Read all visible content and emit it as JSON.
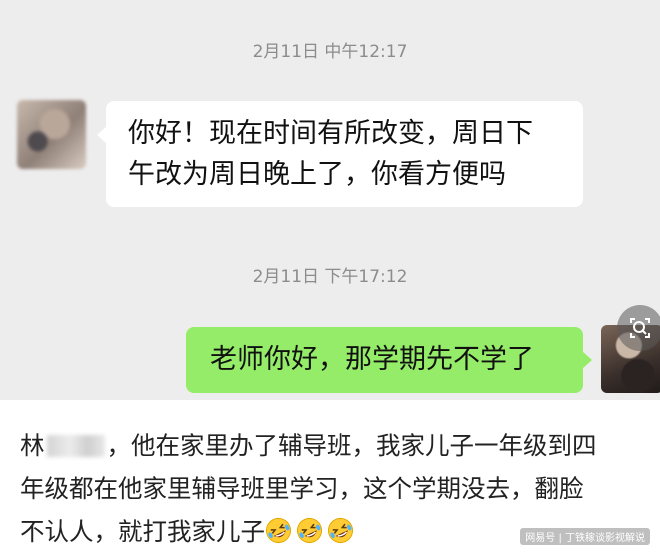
{
  "chat": {
    "timestamp_1": "2月11日 中午12:17",
    "message_1": "你好！现在时间有所改变，周日下午改为周日晚上了，你看方便吗",
    "message_1_line_1": "你好！现在时间有所改变，周日下",
    "message_1_line_2": "午改为周日晚上了，你看方便吗",
    "timestamp_2": "2月11日 下午17:12",
    "message_2": "老师你好，那学期先不学了"
  },
  "caption": {
    "name_prefix": "林",
    "text_line_1": "，他在家里办了辅导班，我家儿子一年级到四",
    "text_line_2": "年级都在他家里辅导班里学习，这个学期没去，翻脸",
    "text_line_3": "不认人，就打我家儿子",
    "emoji_count": 3,
    "emoji_name": "rolling-on-floor-laughing"
  },
  "watermark": "网易号 | 丁铁稼谈影视解说",
  "colors": {
    "chat_bg": "#ededed",
    "incoming_bubble": "#ffffff",
    "outgoing_bubble": "#95ec69",
    "timestamp_text": "#8c8c8c"
  }
}
